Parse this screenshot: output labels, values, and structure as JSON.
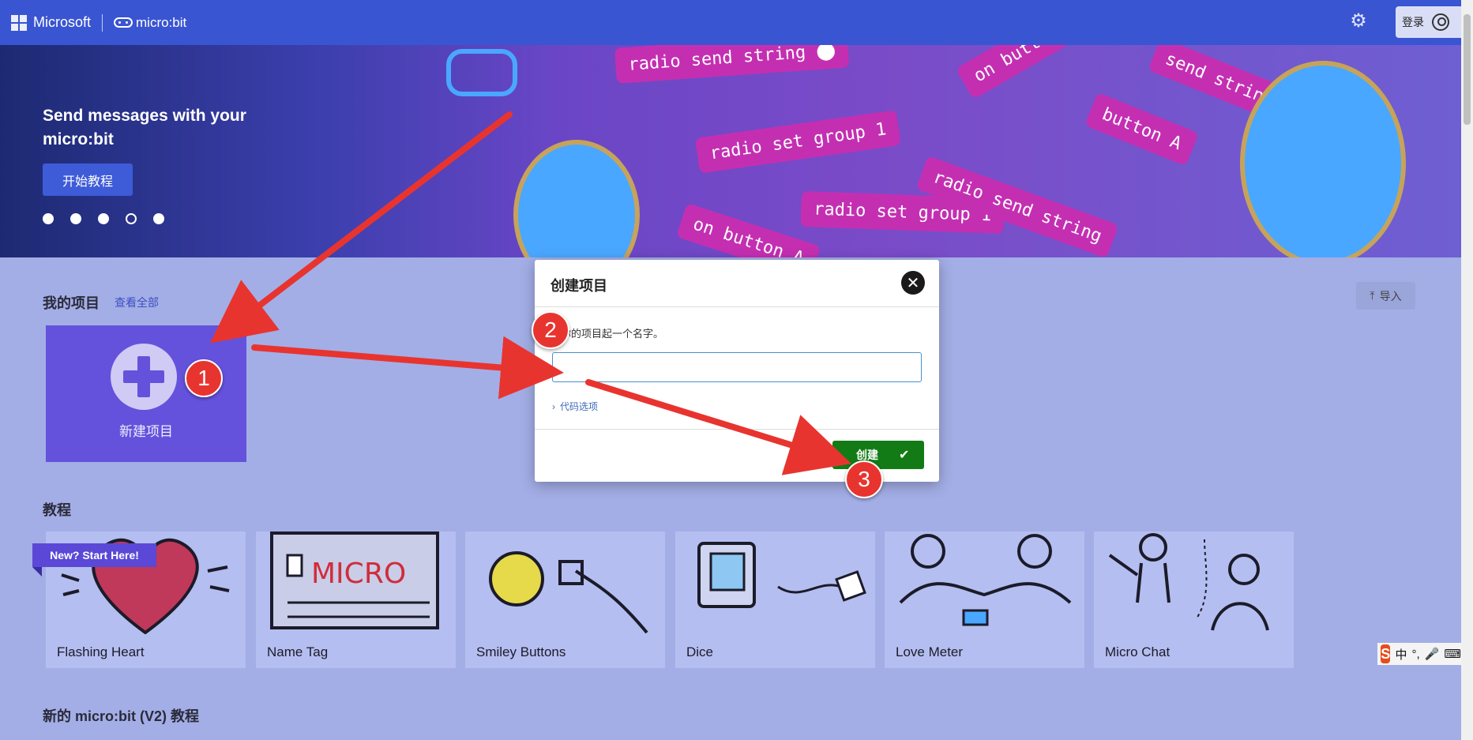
{
  "header": {
    "brand": "Microsoft",
    "product": "micro:bit",
    "settings_icon": "gear-icon",
    "login_label": "登录"
  },
  "hero": {
    "title": "Send messages with your micro:bit",
    "start_tutorial": "开始教程",
    "carousel_active_index": 3,
    "carousel_count": 5,
    "art_blocks": [
      "radio send string",
      "radio set group",
      "radio set group",
      "radio send string",
      "on button A",
      "on button A",
      "send string",
      "button A",
      "1",
      "1"
    ]
  },
  "projects": {
    "title": "我的项目",
    "see_all": "查看全部",
    "import_label": "导入",
    "new_project_label": "新建项目"
  },
  "tutorials": {
    "title": "教程",
    "badge": "New? Start Here!",
    "items": [
      {
        "label": "Flashing Heart"
      },
      {
        "label": "Name Tag",
        "art_text": "MICRO"
      },
      {
        "label": "Smiley Buttons"
      },
      {
        "label": "Dice"
      },
      {
        "label": "Love Meter"
      },
      {
        "label": "Micro Chat"
      }
    ]
  },
  "v2_section": {
    "title": "新的 micro:bit (V2) 教程"
  },
  "dialog": {
    "title": "创建项目",
    "prompt": "给你的项目起一个名字。",
    "input_value": "",
    "code_options": "代码选项",
    "create_label": "创建"
  },
  "annotations": [
    "1",
    "2",
    "3"
  ],
  "ime": {
    "label": "中"
  },
  "colors": {
    "header": "#3a55d2",
    "page_bg": "#a3aee6",
    "new_project_tile": "#6452dc",
    "create_button": "#137b16",
    "annotation": "#e8342f"
  }
}
